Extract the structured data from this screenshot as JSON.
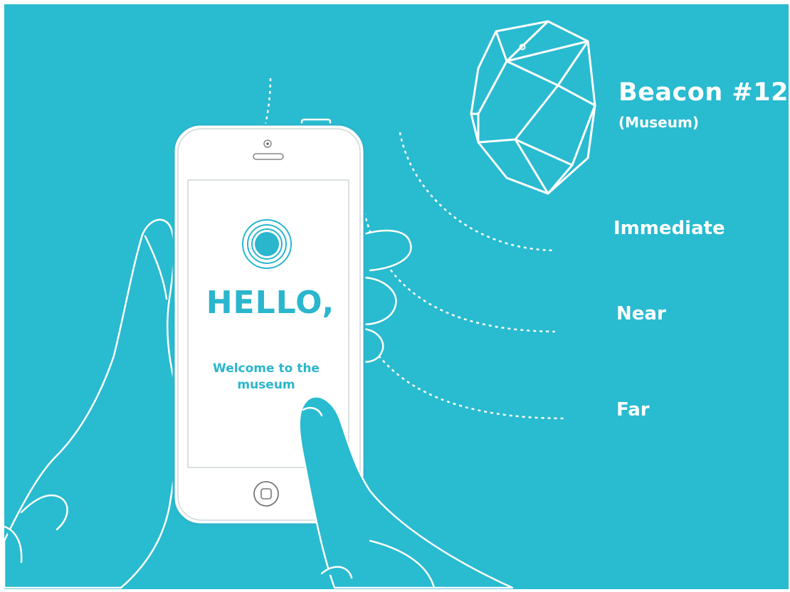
{
  "colors": {
    "background": "#29bbd0",
    "line": "#ffffff",
    "screen_text": "#2ab6cd",
    "phone_body": "#ffffff"
  },
  "beacon": {
    "name": "Beacon #12",
    "location": "(Museum)"
  },
  "ranges": [
    {
      "label": "Immediate"
    },
    {
      "label": "Near"
    },
    {
      "label": "Far"
    }
  ],
  "phone": {
    "greeting": "HELLO,",
    "message_line1": "Welcome to the",
    "message_line2": "museum",
    "icons": [
      "beacon-signal-icon",
      "home-button-icon",
      "camera-icon",
      "speaker-icon"
    ]
  }
}
